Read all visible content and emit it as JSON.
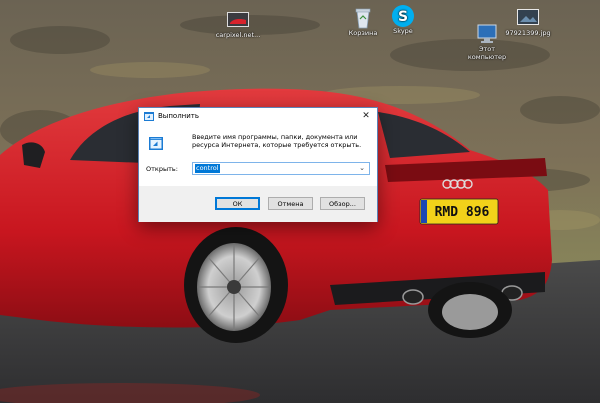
{
  "desktop": {
    "icons": [
      {
        "label": "carpixel.net...",
        "icon": "car-image-file-icon"
      },
      {
        "label": "Корзина",
        "icon": "recycle-bin-icon"
      },
      {
        "label": "Skype",
        "icon": "skype-icon"
      },
      {
        "label": "Этот\nкомпьютер",
        "icon": "this-pc-icon"
      },
      {
        "label": "97921399.jpg",
        "icon": "image-file-icon"
      }
    ],
    "plate": "RMD 896"
  },
  "run_dialog": {
    "title": "Выполнить",
    "description": "Введите имя программы, папки, документа или ресурса Интернета, которые требуется открыть.",
    "open_label": "Открыть:",
    "open_value": "control",
    "ok_label": "ОК",
    "cancel_label": "Отмена",
    "browse_label": "Обзор...",
    "close_glyph": "✕"
  },
  "colors": {
    "car": "#d8232c",
    "accent": "#0078d7",
    "skype": "#00aff0"
  }
}
